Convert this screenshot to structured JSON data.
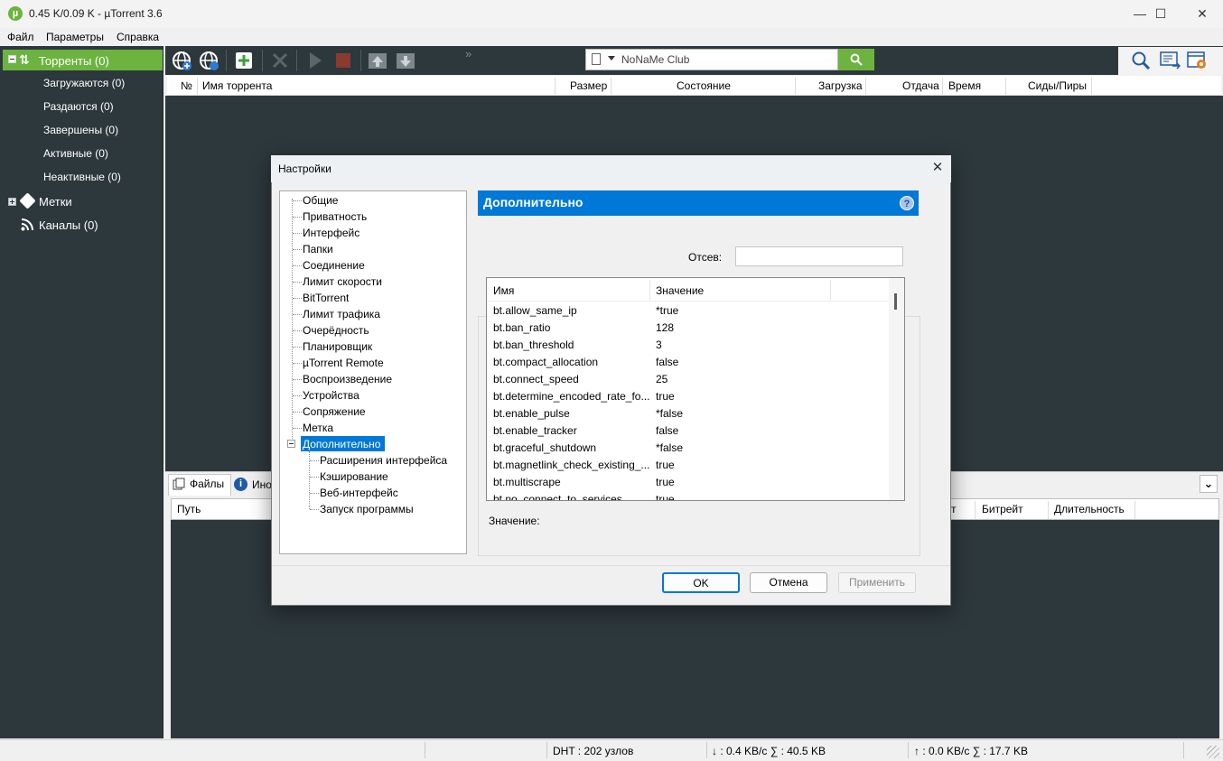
{
  "window": {
    "title": "0.45 K/0.09 K - µTorrent 3.6",
    "app_icon_glyph": "µ",
    "minimize": "—",
    "maximize": "☐",
    "close": "✕"
  },
  "menubar": {
    "items": [
      "Файл",
      "Параметры",
      "Справка"
    ]
  },
  "sidebar": {
    "torrents": "Торренты (0)",
    "torrent_items": [
      "Загружаются (0)",
      "Раздаются (0)",
      "Завершены (0)",
      "Активные (0)",
      "Неактивные (0)"
    ],
    "labels": "Метки",
    "feeds": "Каналы (0)"
  },
  "toolbar": {
    "search_value": "NoNaMe Club",
    "more": "»",
    "icons": [
      "add-url-icon",
      "create-torrent-icon",
      "add-torrent-icon",
      "remove-icon",
      "start-icon",
      "stop-icon",
      "move-up-icon",
      "move-down-icon",
      "search-icon",
      "remote-icon",
      "settings-icon"
    ]
  },
  "list_columns": [
    "№",
    "Имя торрента",
    "Размер",
    "Состояние",
    "Загрузка",
    "Отдача",
    "Время",
    "Сиды/Пиры"
  ],
  "bottom": {
    "tab_files": "Файлы",
    "tab_info": "Ино",
    "collapse": "⌄",
    "col_path": "Путь",
    "col_t": "т",
    "col_bitrate": "Битрейт",
    "col_duration": "Длительность"
  },
  "statusbar": {
    "dht": "DHT : 202 узлов",
    "down": "↓ : 0.4 KB/c  ∑ : 40.5 KB",
    "up": "↑ : 0.0 KB/c  ∑ : 17.7 KB"
  },
  "dialog": {
    "title": "Настройки",
    "close": "✕",
    "tree": [
      "Общие",
      "Приватность",
      "Интерфейс",
      "Папки",
      "Соединение",
      "Лимит скорости",
      "BitTorrent",
      "Лимит трафика",
      "Очерёдность",
      "Планировщик",
      "µTorrent Remote",
      "Воспроизведение",
      "Устройства",
      "Сопряжение",
      "Метка"
    ],
    "tree_selected": "Дополнительно",
    "tree_sub": [
      "Расширения интерфейса",
      "Кэширование",
      "Веб-интерфейс",
      "Запуск программы"
    ],
    "section_title": "Дополнительно",
    "help": "?",
    "filter_label": "Отсев:",
    "filter_value": "",
    "table_col_name": "Имя",
    "table_col_value": "Значение",
    "rows": [
      {
        "name": "bt.allow_same_ip",
        "value": "*true"
      },
      {
        "name": "bt.ban_ratio",
        "value": "128"
      },
      {
        "name": "bt.ban_threshold",
        "value": "3"
      },
      {
        "name": "bt.compact_allocation",
        "value": "false"
      },
      {
        "name": "bt.connect_speed",
        "value": "25"
      },
      {
        "name": "bt.determine_encoded_rate_fo...",
        "value": "true"
      },
      {
        "name": "bt.enable_pulse",
        "value": "*false"
      },
      {
        "name": "bt.enable_tracker",
        "value": "false"
      },
      {
        "name": "bt.graceful_shutdown",
        "value": "*false"
      },
      {
        "name": "bt.magnetlink_check_existing_...",
        "value": "true"
      },
      {
        "name": "bt.multiscrape",
        "value": "true"
      },
      {
        "name": "bt.no_connect_to_services",
        "value": "true"
      }
    ],
    "value_label": "Значение:",
    "ok": "OK",
    "cancel": "Отмена",
    "apply": "Применить"
  },
  "colors": {
    "accent_green": "#6cb33f",
    "dark_bg": "#2d383c",
    "selection_blue": "#0078d7"
  }
}
